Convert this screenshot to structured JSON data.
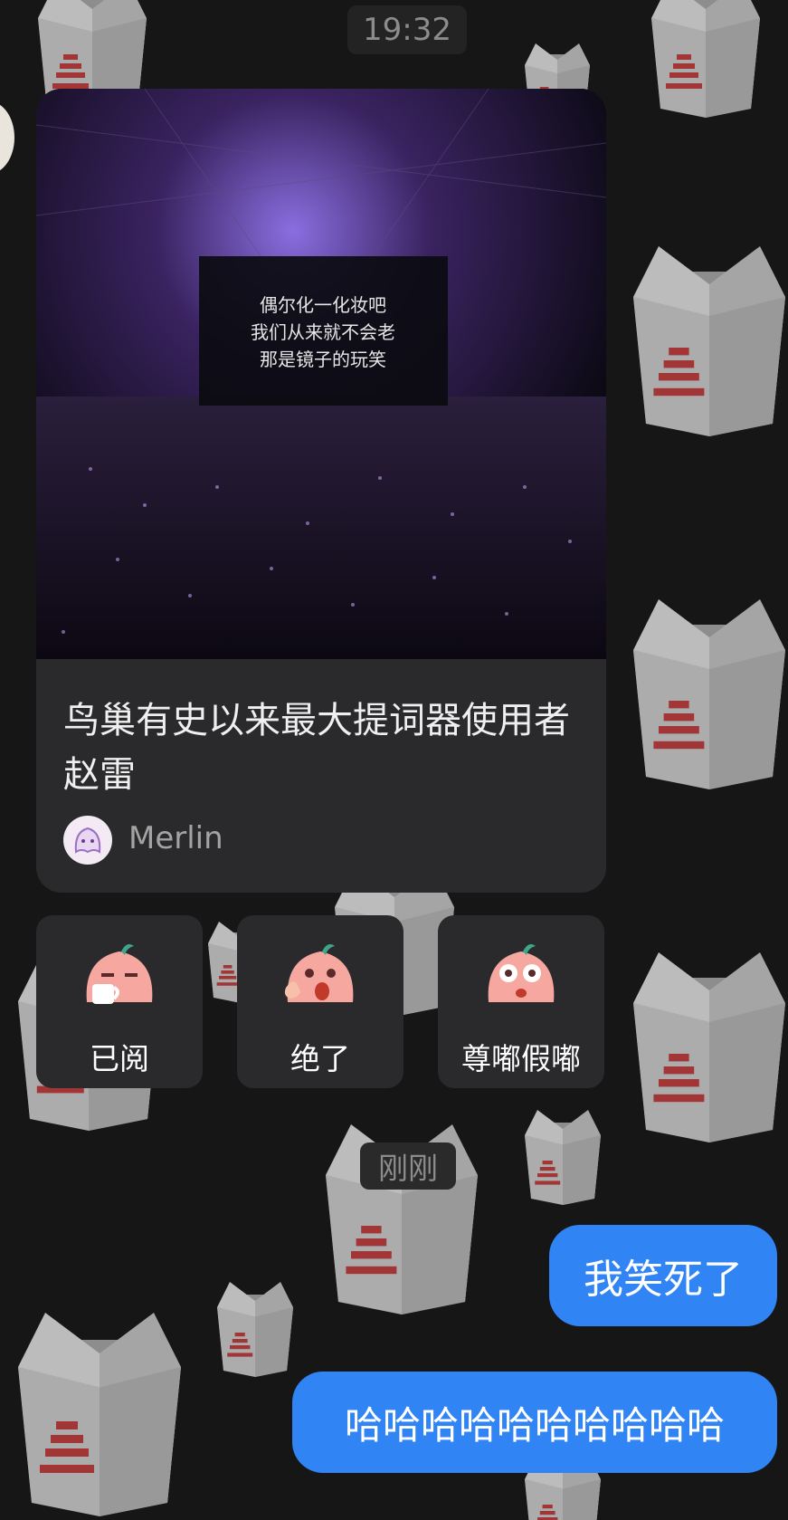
{
  "chat": {
    "timestamp": "19:32",
    "shared_card": {
      "title": "鸟巢有史以来最大提词器使用者赵雷",
      "source_name": "Merlin",
      "image_caption_lines": [
        "偶尔化一化妆吧",
        "我们从来就不会老",
        "那是镜子的玩笑"
      ]
    },
    "reactions": [
      {
        "label": "已阅",
        "icon": "sticker-tea-icon"
      },
      {
        "label": "绝了",
        "icon": "sticker-thumbs-up-icon"
      },
      {
        "label": "尊嘟假嘟",
        "icon": "sticker-surprised-icon"
      }
    ],
    "time_divider": "刚刚",
    "sent_messages": [
      {
        "text": "我笑死了"
      },
      {
        "text": "哈哈哈哈哈哈哈哈哈哈"
      }
    ]
  },
  "colors": {
    "background": "#161616",
    "card": "#2a2a2c",
    "bubble": "#3184f4"
  }
}
